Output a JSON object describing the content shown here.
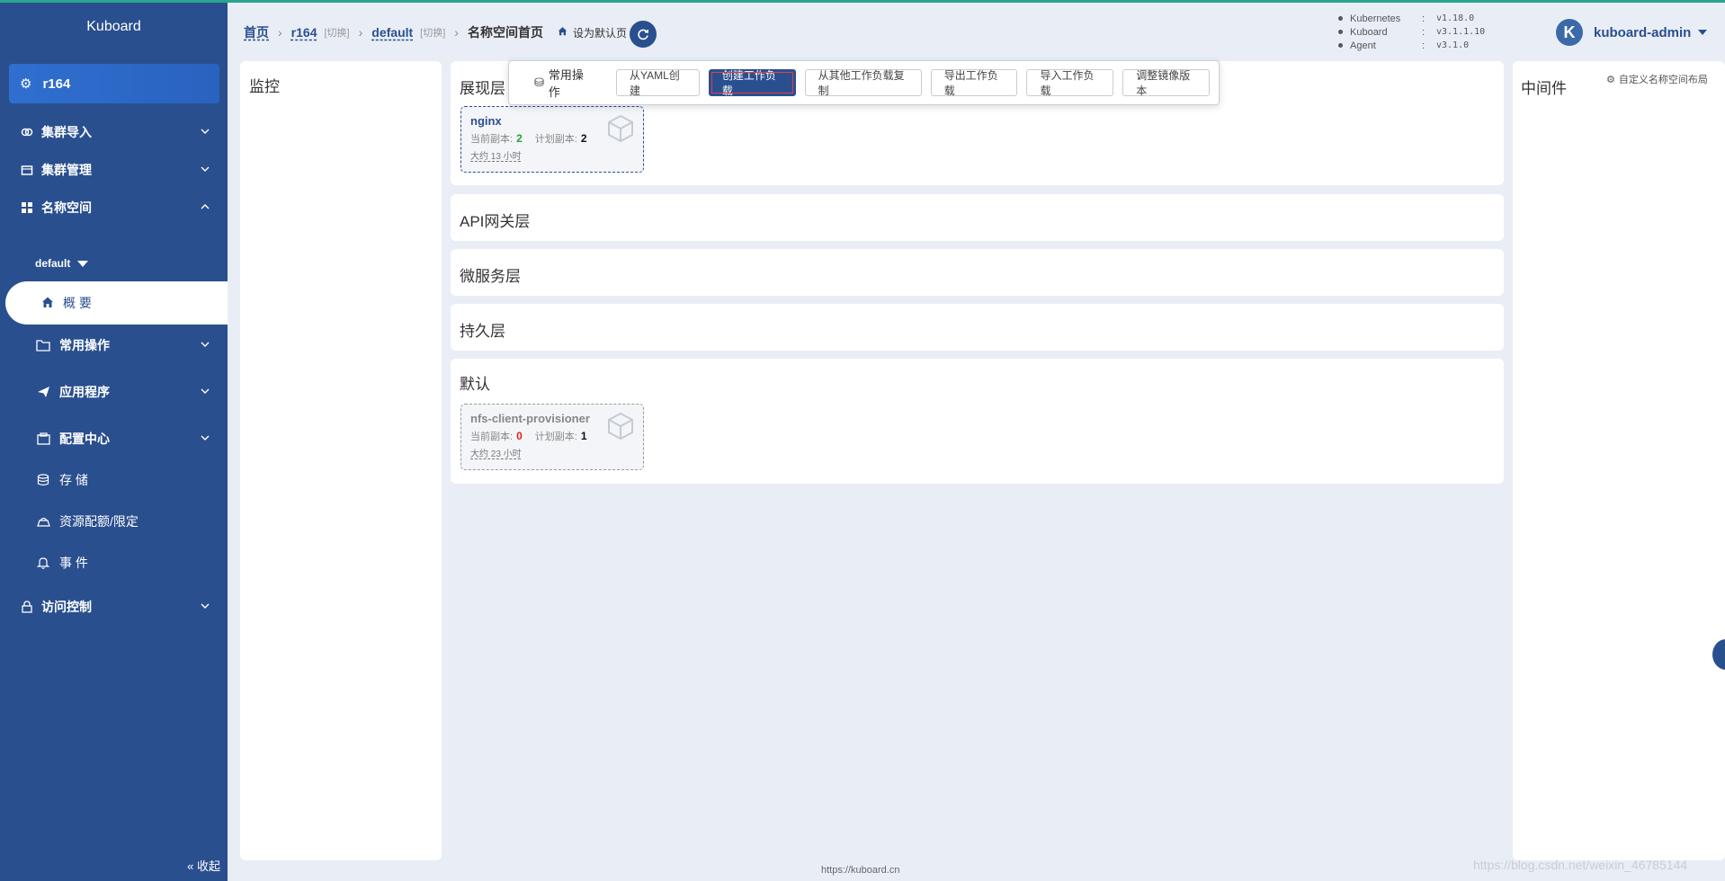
{
  "brand": "Kuboard",
  "cluster": "r164",
  "nav": {
    "cluster_import": "集群导入",
    "cluster_manage": "集群管理",
    "namespace": "名称空间",
    "namespace_selected": "default",
    "overview": "概 要",
    "common_ops": "常用操作",
    "apps": "应用程序",
    "config_center": "配置中心",
    "storage": "存 储",
    "quota": "资源配额/限定",
    "events": "事 件",
    "access_control": "访问控制",
    "collapse": "收起"
  },
  "breadcrumb": {
    "home": "首页",
    "cluster": "r164",
    "cluster_switch": "[切换]",
    "namespace": "default",
    "namespace_switch": "[切换]",
    "current": "名称空间首页",
    "set_default": "设为默认页"
  },
  "versions": [
    {
      "name": "Kubernetes",
      "colon": ":",
      "value": "v1.18.0"
    },
    {
      "name": "Kuboard",
      "colon": ":",
      "value": "v3.1.1.10"
    },
    {
      "name": "Agent",
      "colon": ":",
      "value": "v3.1.0"
    }
  ],
  "user": {
    "avatar_letter": "K",
    "name": "kuboard-admin"
  },
  "panels": {
    "monitor": "监控",
    "presentation": "展现层",
    "api_gateway": "API网关层",
    "microservice": "微服务层",
    "persistence": "持久层",
    "default": "默认",
    "middleware": "中间件"
  },
  "toolbar": {
    "label": "常用操作",
    "buttons": [
      "从YAML创建",
      "创建工作负载",
      "从其他工作负载复制",
      "导出工作负载",
      "导入工作负载",
      "调整镜像版本"
    ]
  },
  "custom_layout": "自定义名称空间布局",
  "workloads": [
    {
      "name": "nginx",
      "current_label": "当前副本:",
      "current": "2",
      "planned_label": "计划副本:",
      "planned": "2",
      "age": "大约 13 小时"
    },
    {
      "name": "nfs-client-provisioner",
      "current_label": "当前副本:",
      "current": "0",
      "planned_label": "计划副本:",
      "planned": "1",
      "age": "大约 23 小时"
    }
  ],
  "footer": "https://kuboard.cn",
  "watermark": "https://blog.csdn.net/weixin_46785144",
  "colors": {
    "sidebar": "#2a4f8f",
    "accent": "#2a4f8f",
    "green": "#22a336",
    "red": "#e02020"
  }
}
